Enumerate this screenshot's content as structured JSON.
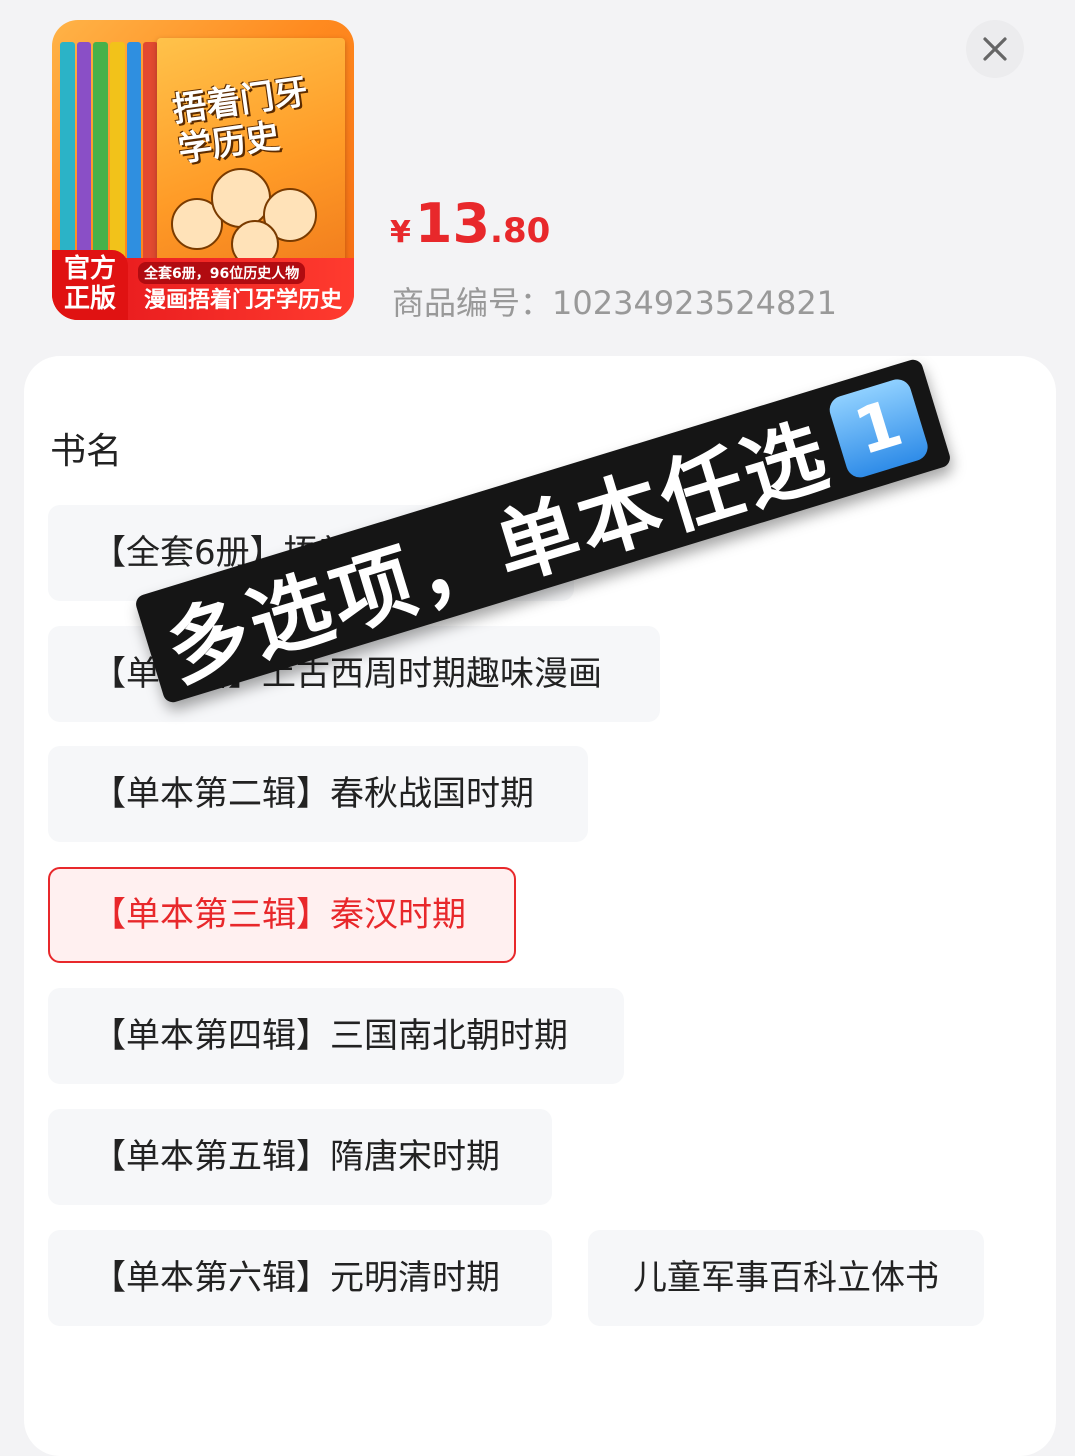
{
  "product": {
    "image_alt": "漫画捂着门牙学历史 全套6册",
    "cover_title": "捂着门牙学历史",
    "cover_tag": "官方正版",
    "cover_subtitle": "全套6册，96位历史人物",
    "cover_banner": "漫画捂着门牙学历史",
    "price_currency": "¥",
    "price_integer": "13",
    "price_decimal": ".80",
    "sku_text": "商品编号：10234923524821"
  },
  "close": {
    "icon": "close-icon"
  },
  "selector": {
    "title": "书名",
    "options": [
      {
        "label": "【全套6册】捂着门牙学历史",
        "selected": false
      },
      {
        "label": "【单本辑】上古西周时期趣味漫画",
        "selected": false
      },
      {
        "label": "【单本第二辑】春秋战国时期",
        "selected": false
      },
      {
        "label": "【单本第三辑】秦汉时期",
        "selected": true
      },
      {
        "label": "【单本第四辑】三国南北朝时期",
        "selected": false
      },
      {
        "label": "【单本第五辑】隋唐宋时期",
        "selected": false
      },
      {
        "label": "【单本第六辑】元明清时期",
        "selected": false
      },
      {
        "label": "儿童军事百科立体书",
        "selected": false
      }
    ]
  },
  "overlay": {
    "text": "多选项，单本任选",
    "badge": "1"
  },
  "colors": {
    "accent": "#e8282b",
    "option_bg": "#f6f7f9"
  }
}
